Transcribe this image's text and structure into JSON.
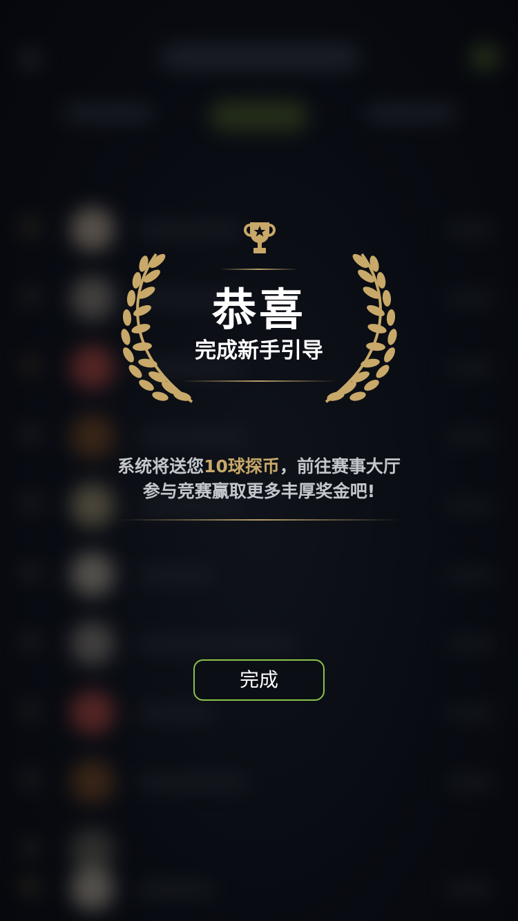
{
  "modal": {
    "title": "恭喜",
    "subtitle": "完成新手引导",
    "message_line1_pre": "系统将送您",
    "message_line1_highlight": "10球探币",
    "message_line1_post": "，前往赛事大厅",
    "message_line2": "参与竞赛赢取更多丰厚奖金吧!",
    "done_button_label": "完成"
  },
  "colors": {
    "gold": "#c8a969",
    "button_border": "#8bc34a",
    "text_primary": "#ffffff",
    "text_secondary": "#c4c7cc",
    "background": "#0b0f17"
  },
  "icons": {
    "trophy": "trophy-icon",
    "laurel_left": "laurel-left-icon",
    "laurel_right": "laurel-right-icon"
  }
}
